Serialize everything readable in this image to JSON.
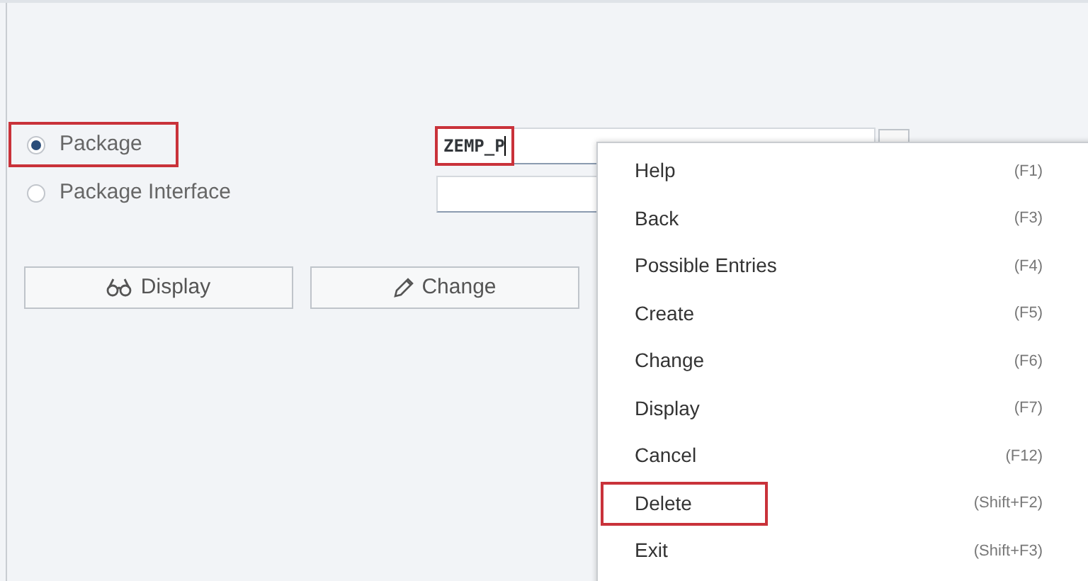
{
  "options": [
    {
      "label": "Package",
      "selected": true,
      "highlighted": true
    },
    {
      "label": "Package Interface",
      "selected": false,
      "highlighted": false
    }
  ],
  "fields": [
    {
      "value": "ZEMP_P",
      "highlighted": true
    }
  ],
  "buttons": [
    {
      "label": "Display",
      "kind": "glasses"
    },
    {
      "label": "Change",
      "kind": "pencil"
    }
  ],
  "context_menu": {
    "items": [
      {
        "label": "Help",
        "shortcut": "(F1)",
        "highlighted": false
      },
      {
        "label": "Back",
        "shortcut": "(F3)",
        "highlighted": false
      },
      {
        "label": "Possible Entries",
        "shortcut": "(F4)",
        "highlighted": false
      },
      {
        "label": "Create",
        "shortcut": "(F5)",
        "highlighted": false
      },
      {
        "label": "Change",
        "shortcut": "(F6)",
        "highlighted": false
      },
      {
        "label": "Display",
        "shortcut": "(F7)",
        "highlighted": false
      },
      {
        "label": "Cancel",
        "shortcut": "(F12)",
        "highlighted": false
      },
      {
        "label": "Delete",
        "shortcut": "(Shift+F2)",
        "highlighted": true
      },
      {
        "label": "Exit",
        "shortcut": "(Shift+F3)",
        "highlighted": false
      }
    ]
  }
}
